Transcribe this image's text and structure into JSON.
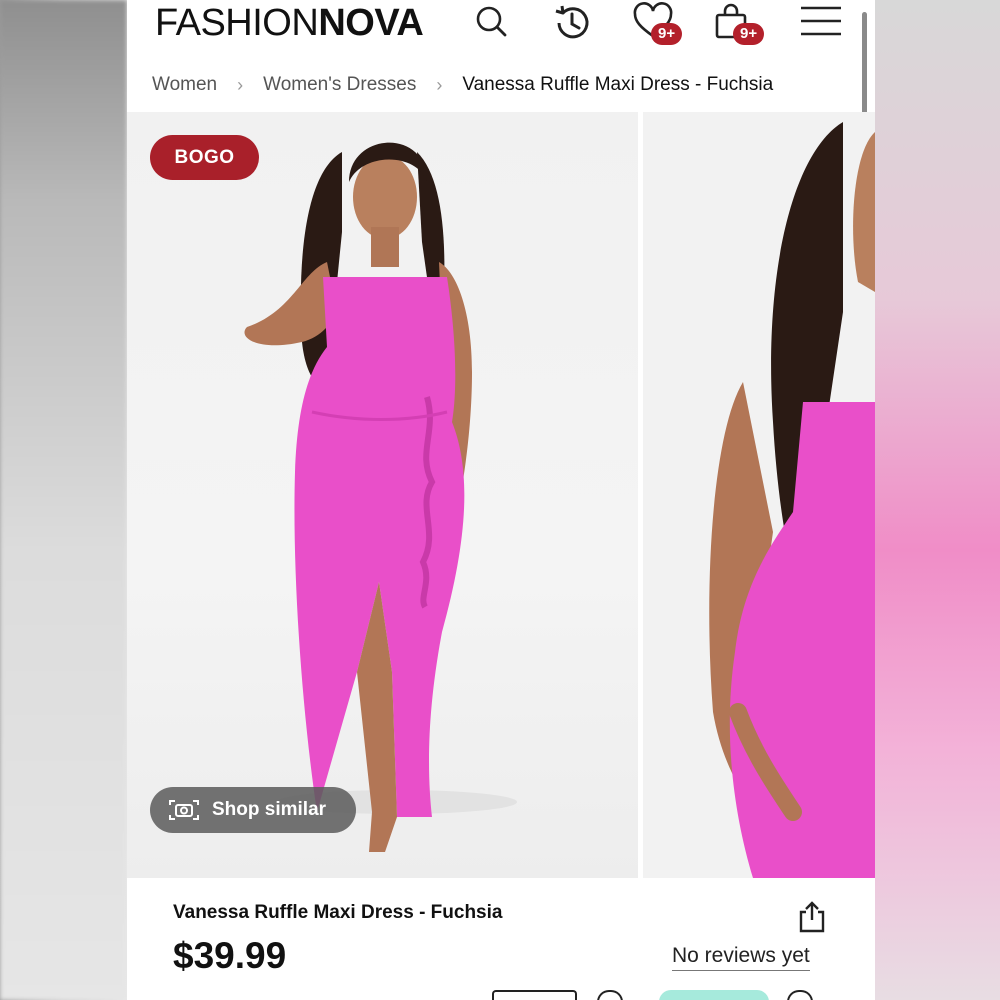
{
  "header": {
    "logo_light": "FASHION",
    "logo_bold": "NOVA",
    "icons": [
      "search-icon",
      "history-icon",
      "heart-icon",
      "bag-icon",
      "menu-icon"
    ],
    "wishlist_badge": "9+",
    "cart_badge": "9+"
  },
  "breadcrumb": {
    "items": [
      "Women",
      "Women's Dresses",
      "Vanessa Ruffle Maxi Dress - Fuchsia"
    ]
  },
  "gallery": {
    "badge": "BOGO",
    "shop_similar": "Shop similar",
    "dress_color": "#e94fc9"
  },
  "product": {
    "title": "Vanessa Ruffle Maxi Dress - Fuchsia",
    "price": "$39.99",
    "reviews": "No reviews yet"
  },
  "colors": {
    "badge_red": "#a9202a",
    "fuchsia": "#e94fc9"
  }
}
